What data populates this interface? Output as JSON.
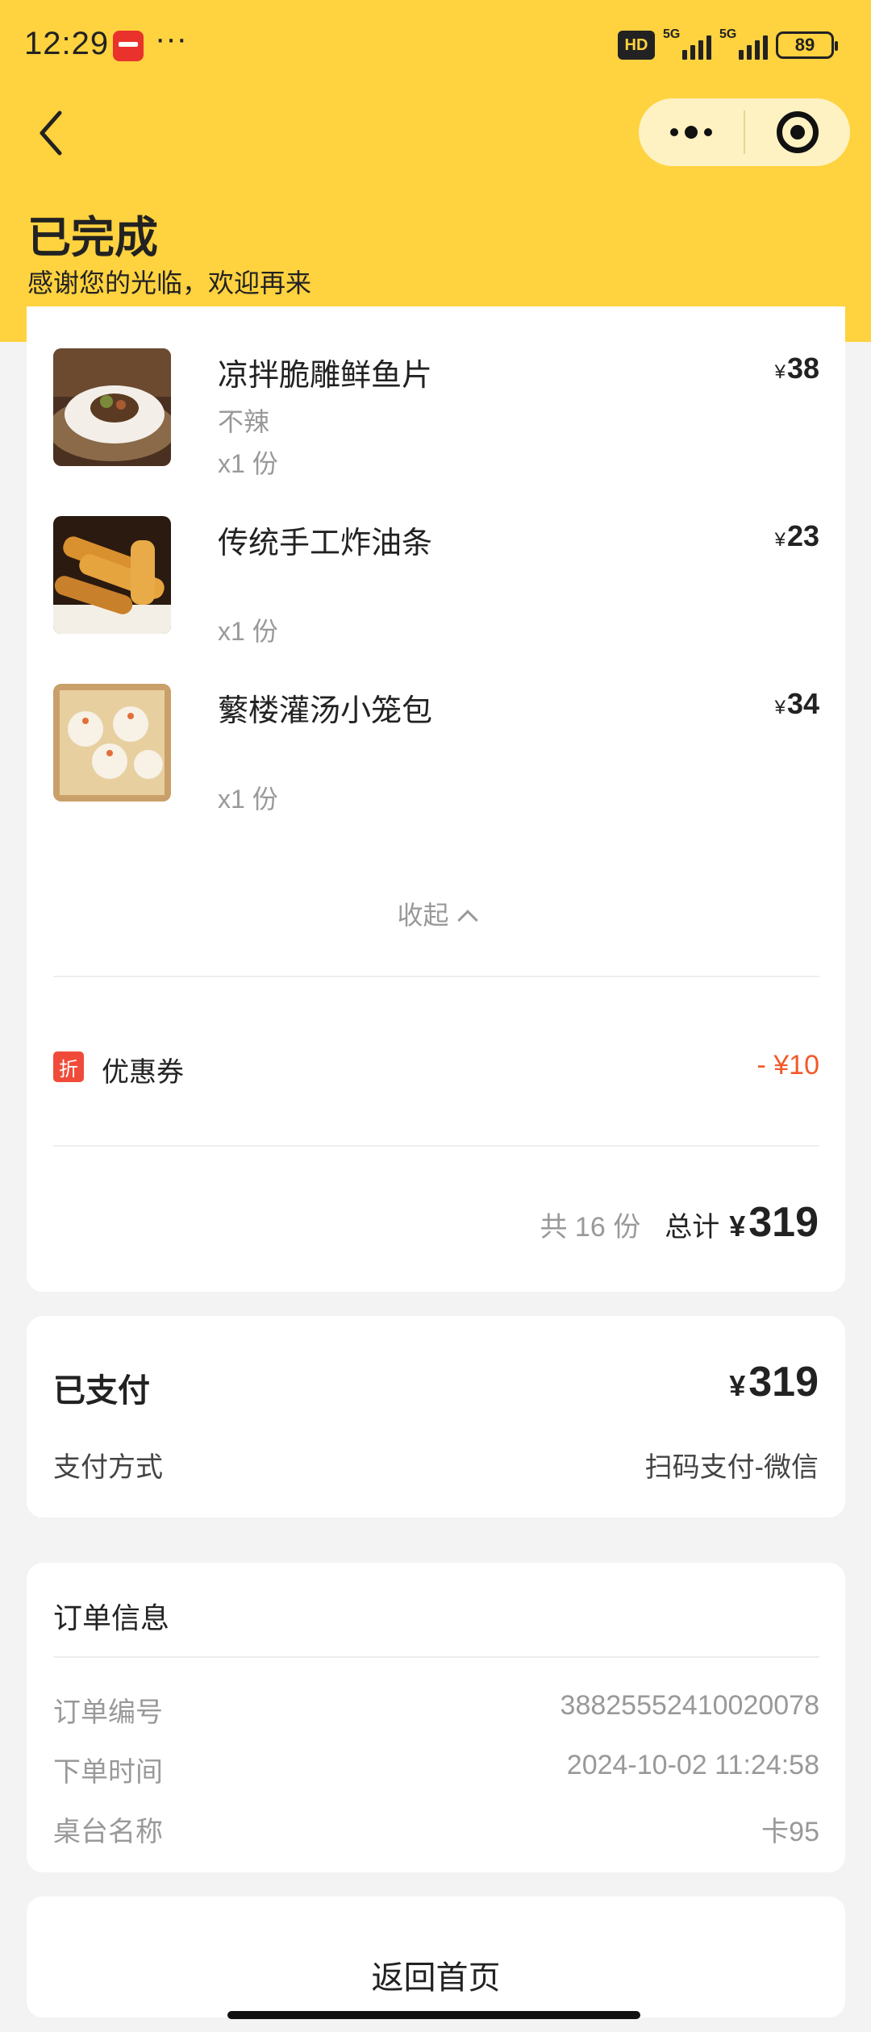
{
  "statusbar": {
    "time": "12:29",
    "dots": "···",
    "hd": "HD",
    "net1": "5G",
    "net2": "5G",
    "battery": "89"
  },
  "header": {
    "title": "已完成",
    "subtitle": "感谢您的光临，欢迎再来"
  },
  "order_items": [
    {
      "name": "凉拌脆雕鲜鱼片",
      "spec": "不辣",
      "qty": "x1 份",
      "currency": "¥",
      "price": "38"
    },
    {
      "name": "传统手工炸油条",
      "spec": "",
      "qty": "x1 份",
      "currency": "¥",
      "price": "23"
    },
    {
      "name": "蘩楼灌汤小笼包",
      "spec": "",
      "qty": "x1 份",
      "currency": "¥",
      "price": "34"
    }
  ],
  "collapse_label": "收起",
  "coupon": {
    "badge": "折",
    "label": "优惠券",
    "value": "- ¥10"
  },
  "total": {
    "count": "共 16 份",
    "label": "总计",
    "currency": "¥",
    "amount": "319"
  },
  "payment": {
    "title": "已支付",
    "currency": "¥",
    "amount": "319",
    "method_label": "支付方式",
    "method_value": "扫码支付-微信"
  },
  "order_info": {
    "title": "订单信息",
    "rows": [
      {
        "label": "订单编号",
        "value": "38825552410020078"
      },
      {
        "label": "下单时间",
        "value": "2024-10-02 11:24:58"
      },
      {
        "label": "桌台名称",
        "value": "卡95"
      }
    ]
  },
  "home_button": "返回首页",
  "colors": {
    "header_bg": "#ffd23f",
    "discount": "#f15a2a",
    "badge": "#f04b3a"
  }
}
